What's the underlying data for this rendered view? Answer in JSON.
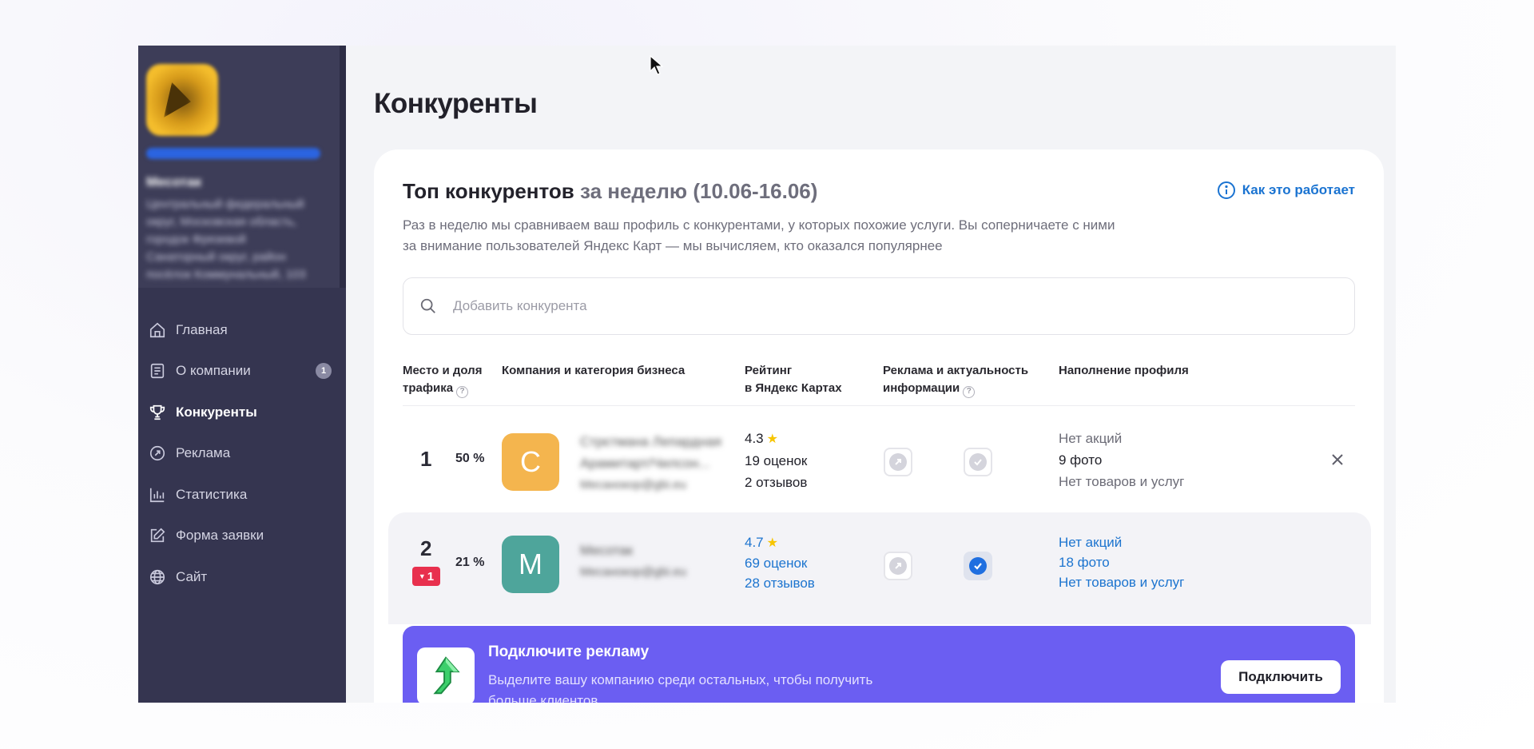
{
  "sidebar": {
    "business_name_blurred": "Месотак",
    "address_blurred": [
      "Центральный федеральный",
      "округ, Московская область,",
      "городок Фрязевой",
      "Санаторный округ, район",
      "посёлок Коммунальный, 103"
    ],
    "nav": [
      {
        "label": "Главная",
        "icon": "home-icon"
      },
      {
        "label": "О компании",
        "icon": "document-icon",
        "badge": "1"
      },
      {
        "label": "Конкуренты",
        "icon": "trophy-icon",
        "active": true
      },
      {
        "label": "Реклама",
        "icon": "compass-icon"
      },
      {
        "label": "Статистика",
        "icon": "bar-chart-icon"
      },
      {
        "label": "Форма заявки",
        "icon": "edit-icon"
      },
      {
        "label": "Сайт",
        "icon": "globe-icon"
      }
    ]
  },
  "page": {
    "title": "Конкуренты"
  },
  "card": {
    "heading_main": "Топ конкурентов",
    "heading_period": "за неделю (10.06-16.06)",
    "how_it_works": "Как это работает",
    "description": "Раз в неделю мы сравниваем ваш профиль с конкурентами, у которых похожие услуги. Вы соперничаете с ними за внимание пользователей Яндекс Карт — мы вычисляем, кто оказался популярнее",
    "search_placeholder": "Добавить конкурента"
  },
  "table": {
    "headers": {
      "place_line1": "Место и доля",
      "place_line2": "трафика",
      "company": "Компания и категория бизнеса",
      "rating_line1": "Рейтинг",
      "rating_line2": "в Яндекс Картах",
      "ads_line1": "Реклама и актуальность",
      "ads_line2": "информации",
      "profile": "Наполнение профиля"
    },
    "rows": [
      {
        "place": "1",
        "share": "50 %",
        "avatar_letter": "С",
        "avatar_color": "#f4b54e",
        "company_blurred": [
          "Стрєтмана Лепардная",
          "Арамитарт/Чилсон...",
          "Месанокор@gbi.eu"
        ],
        "rating": "4.3",
        "ratings_count": "19 оценок",
        "reviews": "2 отзывов",
        "promos": "Нет акций",
        "photos": "9 фото",
        "goods": "Нет товаров и услуг"
      },
      {
        "place": "2",
        "share": "21 %",
        "rank_change": "1",
        "avatar_letter": "М",
        "avatar_color": "#4ea59b",
        "company_blurred": [
          "Месотак",
          "Месанокор@gbi.eu"
        ],
        "rating": "4.7",
        "ratings_count": "69 оценок",
        "reviews": "28 отзывов",
        "promos": "Нет акций",
        "photos": "18 фото",
        "goods": "Нет товаров и услуг"
      }
    ]
  },
  "promo": {
    "title": "Подключите рекламу",
    "description": "Выделите вашу компанию среди остальных, чтобы получить больше клиентов",
    "button": "Подключить"
  },
  "colors": {
    "sidebar_bg": "#353550",
    "accent_blue": "#1a73d1",
    "promo_bg": "#6b5ef2",
    "badge_red": "#e8304e"
  }
}
